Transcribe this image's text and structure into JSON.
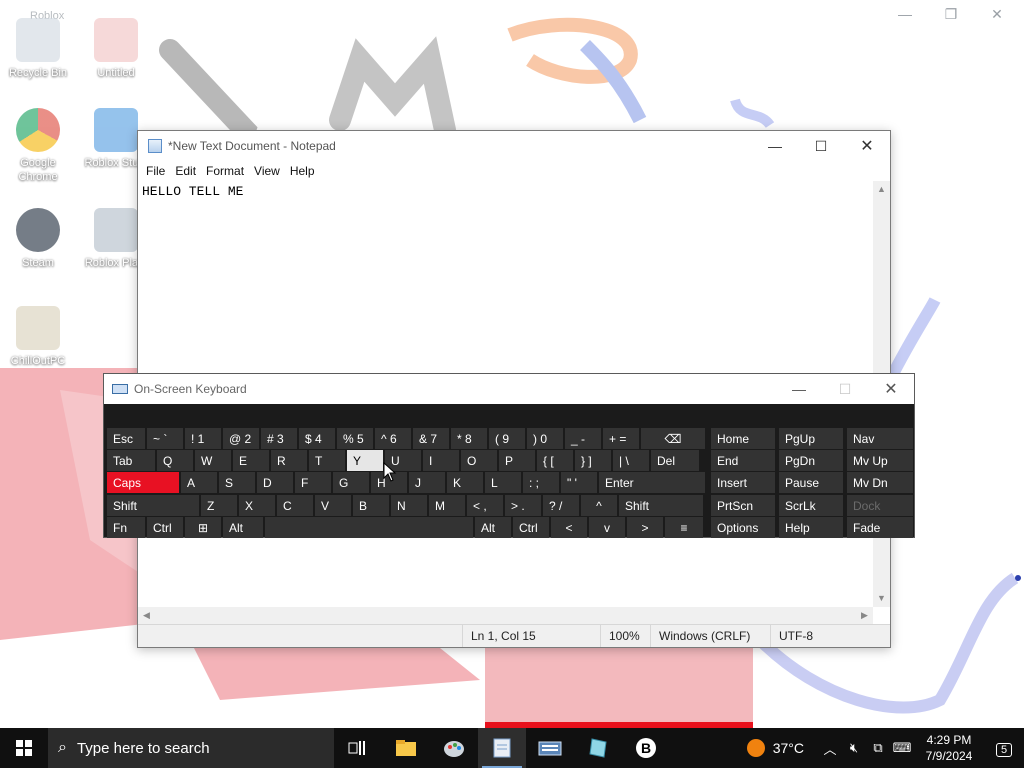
{
  "background_window": {
    "title": "Roblox",
    "controls": [
      "minimize",
      "restore",
      "close"
    ]
  },
  "desktop_icons": [
    {
      "label": "Recycle Bin",
      "icon": "recycle-bin-icon"
    },
    {
      "label": "Untitled",
      "icon": "paint-file-icon"
    },
    {
      "label": "Google Chrome",
      "icon": "chrome-icon"
    },
    {
      "label": "Roblox Stu...",
      "icon": "roblox-studio-icon"
    },
    {
      "label": "Steam",
      "icon": "steam-icon"
    },
    {
      "label": "Roblox Pla...",
      "icon": "roblox-player-icon"
    },
    {
      "label": "ChillOutPC",
      "icon": "chilloutpc-icon"
    }
  ],
  "notepad": {
    "title": "*New Text Document - Notepad",
    "menu": [
      "File",
      "Edit",
      "Format",
      "View",
      "Help"
    ],
    "content": "HELLO TELL ME",
    "status": {
      "position": "Ln 1, Col 15",
      "zoom": "100%",
      "line_ending": "Windows (CRLF)",
      "encoding": "UTF-8"
    }
  },
  "osk": {
    "title": "On-Screen Keyboard",
    "rows": [
      [
        "Esc",
        "~ `",
        "! 1",
        "@ 2",
        "# 3",
        "$ 4",
        "% 5",
        "^ 6",
        "& 7",
        "* 8",
        "( 9",
        ") 0",
        "_ -",
        "+ =",
        "⌫"
      ],
      [
        "Tab",
        "Q",
        "W",
        "E",
        "R",
        "T",
        "Y",
        "U",
        "I",
        "O",
        "P",
        "{ [",
        "} ]",
        "| \\",
        "Del"
      ],
      [
        "Caps",
        "A",
        "S",
        "D",
        "F",
        "G",
        "H",
        "J",
        "K",
        "L",
        ": ;",
        "\" '",
        "Enter"
      ],
      [
        "Shift",
        "Z",
        "X",
        "C",
        "V",
        "B",
        "N",
        "M",
        "< ,",
        "> .",
        "? /",
        "^",
        "Shift"
      ],
      [
        "Fn",
        "Ctrl",
        "⊞",
        "Alt",
        "",
        "Alt",
        "Ctrl",
        "<",
        "v",
        ">",
        "≡"
      ]
    ],
    "nav_keys": [
      [
        "Home",
        "PgUp",
        "Nav"
      ],
      [
        "End",
        "PgDn",
        "Mv Up"
      ],
      [
        "Insert",
        "Pause",
        "Mv Dn"
      ],
      [
        "PrtScn",
        "ScrLk",
        "Dock"
      ],
      [
        "Options",
        "Help",
        "Fade"
      ]
    ],
    "highlighted_key": "Y",
    "active_key": "Caps"
  },
  "taskbar": {
    "search_placeholder": "Type here to search",
    "apps": [
      "task-view-icon",
      "file-explorer-icon",
      "paint-icon",
      "notepad-icon",
      "osk-icon",
      "roblox-icon",
      "bitwarden-icon"
    ],
    "weather": "37°C",
    "time": "4:29 PM",
    "date": "7/9/2024",
    "notifications": "5"
  },
  "colors": {
    "caps_active": "#e81123",
    "osk_key": "#333333",
    "osk_bg": "#1b1b1b",
    "taskbar": "#101010"
  }
}
